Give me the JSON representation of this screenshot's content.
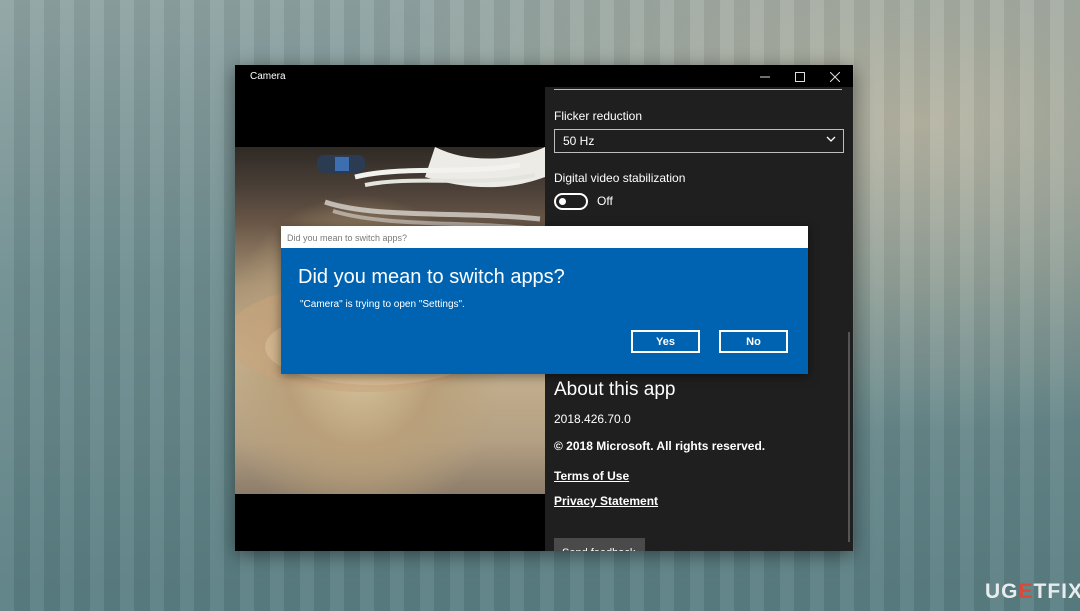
{
  "window": {
    "title": "Camera",
    "controls": {
      "minimize": "minimize-icon",
      "maximize": "maximize-icon",
      "close": "close-icon"
    }
  },
  "settings": {
    "flicker_label": "Flicker reduction",
    "flicker_value": "50 Hz",
    "stabilization_label": "Digital video stabilization",
    "stabilization_state": "Off",
    "about_title": "About this app",
    "version": "2018.426.70.0",
    "copyright": "© 2018 Microsoft. All rights reserved.",
    "terms_link": "Terms of Use",
    "privacy_link": "Privacy Statement",
    "feedback_button": "Send feedback"
  },
  "dialog": {
    "window_title": "Did you mean to switch apps?",
    "heading": "Did you mean to switch apps?",
    "message": "\"Camera\" is trying to open \"Settings\".",
    "yes_label": "Yes",
    "no_label": "No",
    "accent_color": "#0063b1"
  },
  "watermark": {
    "part1": "UG",
    "part2": "E",
    "part3": "TFIX"
  }
}
